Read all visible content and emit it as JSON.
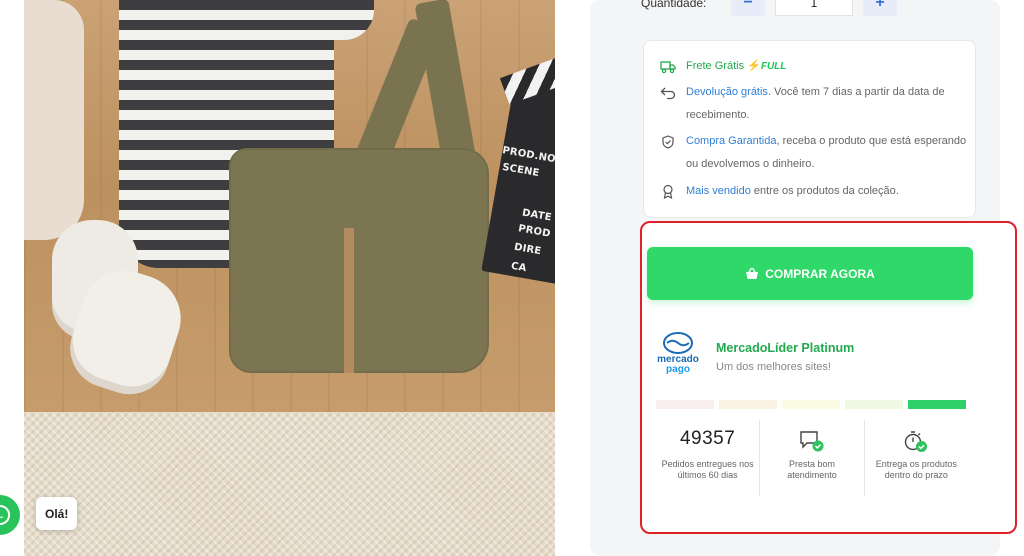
{
  "product_photo": {
    "alt": "",
    "clapperboard": [
      "PROD.NO.",
      "SCENE",
      "DATE",
      "PROD",
      "DIRE",
      "CA"
    ]
  },
  "whatsapp": {
    "greeting": "Olá!"
  },
  "quantity": {
    "label": "Quantidade:",
    "minus": "−",
    "value": "1",
    "plus": "+"
  },
  "benefits": {
    "shipping": {
      "label": "Frete Grátis",
      "badge": "FULL"
    },
    "returns": {
      "link": "Devolução grátis",
      "text": ". Você tem 7 dias a partir da data de recebimento."
    },
    "guarantee": {
      "link": "Compra Garantida",
      "text": ", receba o produto que está esperando ou devolvemos o dinheiro."
    },
    "bestseller": {
      "link": "Mais vendido",
      "text": " entre os produtos da coleção."
    }
  },
  "buy_button": {
    "label": "COMPRAR AGORA"
  },
  "seller": {
    "logo_words": [
      "mercado",
      "pago"
    ],
    "title": "MercadoLíder Platinum",
    "subtitle": "Um dos melhores sites!",
    "reputation_colors": [
      "#fbeeee",
      "#fbf3e6",
      "#fbfbe2",
      "#eef8e2",
      "#2ed067"
    ],
    "reputation_level": 5
  },
  "stats": [
    {
      "value": "49357",
      "caption": "Pedidos entregues nos últimos 60 dias"
    },
    {
      "icon": "chat-check-icon",
      "caption": "Presta bom atendimento"
    },
    {
      "icon": "timer-check-icon",
      "caption": "Entrega os produtos dentro do prazo"
    }
  ],
  "colors": {
    "accent_green": "#2fd868",
    "link_blue": "#2f7fd4",
    "highlight_border": "#e0202a"
  }
}
